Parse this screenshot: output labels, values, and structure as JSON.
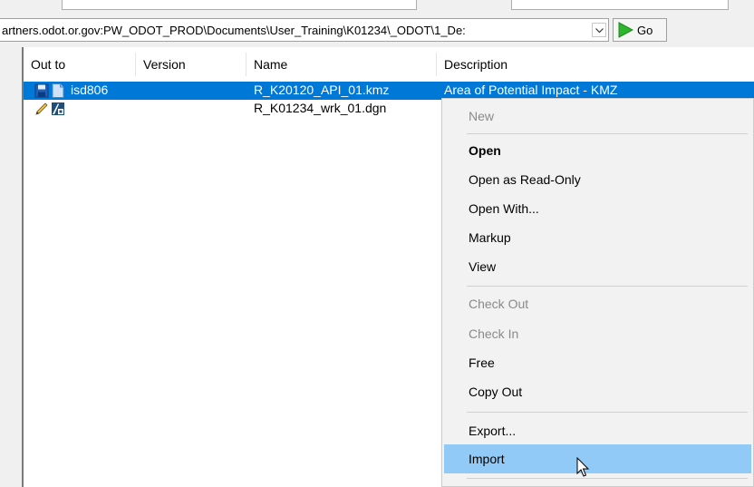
{
  "address_bar": {
    "path": "artners.odot.or.gov:PW_ODOT_PROD\\Documents\\User_Training\\K01234\\_ODOT\\1_De:",
    "go_label": "Go"
  },
  "columns": [
    "Out to",
    "Version",
    "Name",
    "Description"
  ],
  "rows": [
    {
      "out_to": "isd806",
      "version": "",
      "name": "R_K20120_API_01.kmz",
      "description": "Area of Potential Impact - KMZ",
      "selected": true
    },
    {
      "out_to": "",
      "version": "",
      "name": "R_K01234_wrk_01.dgn",
      "description": "",
      "selected": false
    }
  ],
  "context_menu": {
    "items": [
      {
        "label": "New",
        "state": "disabled"
      },
      {
        "label": "Open",
        "state": "bold"
      },
      {
        "label": "Open as Read-Only",
        "state": "normal"
      },
      {
        "label": "Open With...",
        "state": "normal"
      },
      {
        "label": "Markup",
        "state": "normal"
      },
      {
        "label": "View",
        "state": "normal"
      },
      {
        "label": "Check Out",
        "state": "disabled"
      },
      {
        "label": "Check In",
        "state": "disabled"
      },
      {
        "label": "Free",
        "state": "normal"
      },
      {
        "label": "Copy Out",
        "state": "normal"
      },
      {
        "label": "Export...",
        "state": "normal"
      },
      {
        "label": "Import",
        "state": "hover"
      }
    ]
  },
  "colors": {
    "selection": "#0078d7",
    "menu_hover": "#91c9f7",
    "disabled_text": "#8a8a8a",
    "go_arrow": "#2db52d"
  },
  "icons": [
    "save-icon",
    "document-icon",
    "pencil-icon",
    "microstation-file-icon",
    "chevron-down-icon",
    "go-arrow-icon",
    "mouse-cursor-icon"
  ]
}
